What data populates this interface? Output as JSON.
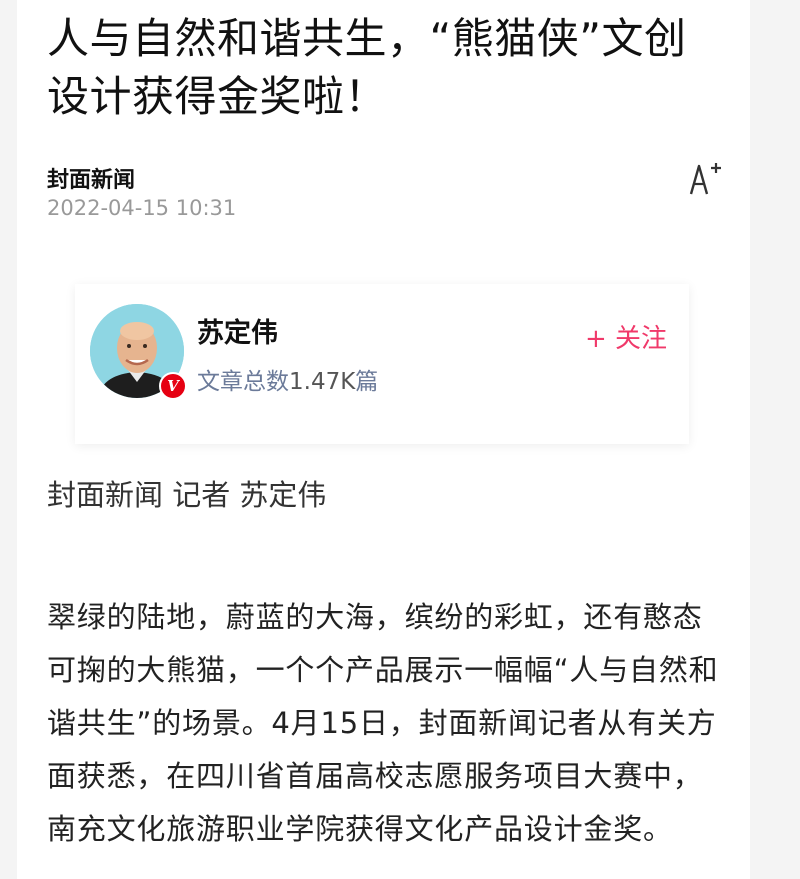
{
  "article": {
    "title": "人与自然和谐共生，“熊猫侠”文创设计获得金奖啦！",
    "source": "封面新闻",
    "date": "2022-04-15 10:31",
    "byline": "封面新闻 记者 苏定伟",
    "body": "翠绿的陆地，蔚蓝的大海，缤纷的彩虹，还有憨态可掬的大熊猫，一个个产品展示一幅幅“人与自然和谐共生”的场景。4月15日，封面新闻记者从有关方面获悉，在四川省首届高校志愿服务项目大赛中，南充文化旅游职业学院获得文化产品设计金奖。"
  },
  "author": {
    "name": "苏定伟",
    "stats_label": "文章总数",
    "stats_count": "1.47K",
    "stats_unit": "篇",
    "follow_label": "+ 关注",
    "badge": "V"
  },
  "toolbar": {
    "font_size_icon": "font-size-increase-icon"
  },
  "colors": {
    "follow": "#f0396a",
    "badge": "#e60012",
    "date": "#999999",
    "stats_label": "#6b7a99"
  }
}
